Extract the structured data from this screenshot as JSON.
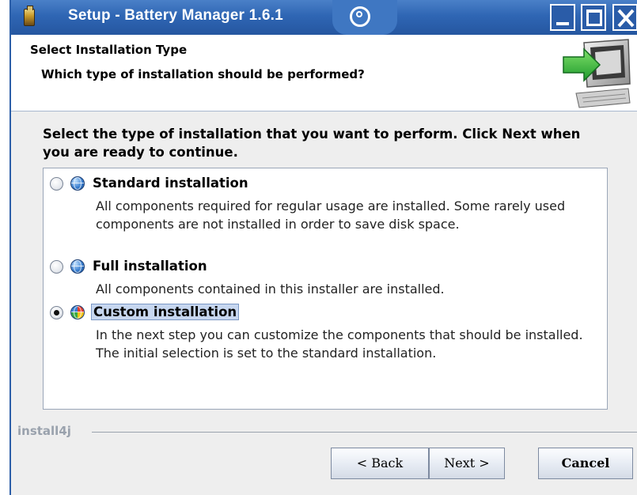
{
  "window": {
    "title": "Setup - Battery Manager 1.6.1"
  },
  "header": {
    "title": "Select Installation Type",
    "subtitle": "Which type of installation should be performed?"
  },
  "body": {
    "instruction": "Select the type of installation that you want to perform. Click Next when you are ready to continue."
  },
  "options": [
    {
      "label": "Standard installation",
      "description": "All components required for regular usage are installed. Some rarely used components are not installed in order to save disk space.",
      "selected": false
    },
    {
      "label": "Full installation",
      "description": "All components contained in this installer are installed.",
      "selected": false
    },
    {
      "label": "Custom installation",
      "description": "In the next step you can customize the components that should be installed. The initial selection is set to the standard installation.",
      "selected": true
    }
  ],
  "footer": {
    "brand": "install4j",
    "back_label": "< Back",
    "next_label": "Next >",
    "cancel_label": "Cancel"
  },
  "colors": {
    "titlebar": "#2f66b4",
    "selection": "#c7d7f0",
    "window_bg": "#eeeeee"
  }
}
